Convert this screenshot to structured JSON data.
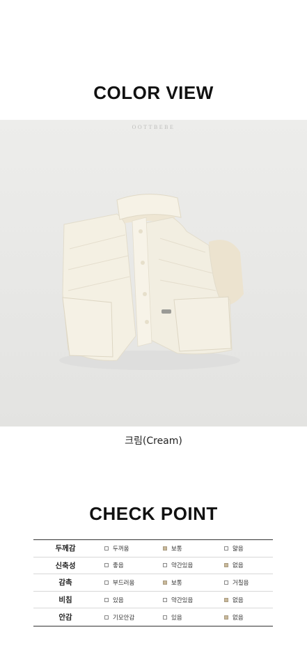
{
  "color_view": {
    "title": "COLOR VIEW",
    "brand_watermark": "OOTTBEBE",
    "caption": "크림(Cream)"
  },
  "check_point": {
    "title": "CHECK POINT",
    "rows": [
      {
        "label": "두께감",
        "options": [
          {
            "text": "두꺼움",
            "checked": false
          },
          {
            "text": "보통",
            "checked": true
          },
          {
            "text": "얇음",
            "checked": false
          }
        ]
      },
      {
        "label": "신축성",
        "options": [
          {
            "text": "좋음",
            "checked": false
          },
          {
            "text": "약간있음",
            "checked": false
          },
          {
            "text": "없음",
            "checked": true
          }
        ]
      },
      {
        "label": "감촉",
        "options": [
          {
            "text": "부드러움",
            "checked": false
          },
          {
            "text": "보통",
            "checked": true
          },
          {
            "text": "거칠음",
            "checked": false
          }
        ]
      },
      {
        "label": "비침",
        "options": [
          {
            "text": "있음",
            "checked": false
          },
          {
            "text": "약간있음",
            "checked": false
          },
          {
            "text": "없음",
            "checked": true
          }
        ]
      },
      {
        "label": "안감",
        "options": [
          {
            "text": "기모안감",
            "checked": false
          },
          {
            "text": "있음",
            "checked": false
          },
          {
            "text": "없음",
            "checked": true
          }
        ]
      }
    ]
  },
  "colors": {
    "checked_box": "#c9b99a",
    "photo_background": "#e9e9e7",
    "vest_cream": "#f3efe2"
  }
}
